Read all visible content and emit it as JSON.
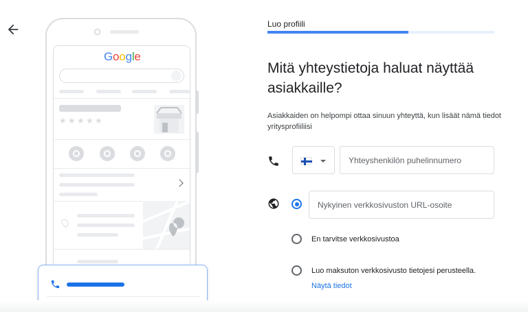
{
  "nav": {
    "back_icon": "arrow-back-icon"
  },
  "illustration": {
    "logo": [
      "G",
      "o",
      "o",
      "g",
      "l",
      "e"
    ],
    "logo_colors": [
      "#4285f4",
      "#ea4335",
      "#fbbc05",
      "#4285f4",
      "#34a853",
      "#ea4335"
    ],
    "stars": [
      "★",
      "★",
      "★",
      "★",
      "★"
    ]
  },
  "form": {
    "step_title": "Luo profiili",
    "progress": 0.62,
    "heading": "Mitä yhteystietoja haluat näyttää asiakkaille?",
    "description": "Asiakkaiden on helpompi ottaa sinuun yhteyttä, kun lisäät nämä tiedot yritysprofiiliisi",
    "phone": {
      "icon": "phone-icon",
      "country_flag": "finland-flag-icon",
      "placeholder": "Yhteyshenkilön puhelinnumero",
      "value": ""
    },
    "website": {
      "icon": "globe-icon",
      "placeholder": "Nykyinen verkkosivuston URL-osoite",
      "value": "",
      "options": [
        {
          "label": "En tarvitse verkkosivustoa",
          "selected": false
        },
        {
          "label": "Luo maksuton verkkosivusto tietojesi perusteella.",
          "selected": false
        }
      ],
      "link": "Näytä tiedot"
    }
  },
  "colors": {
    "accent": "#1a73e8",
    "progress_track": "#e8f0fe"
  }
}
